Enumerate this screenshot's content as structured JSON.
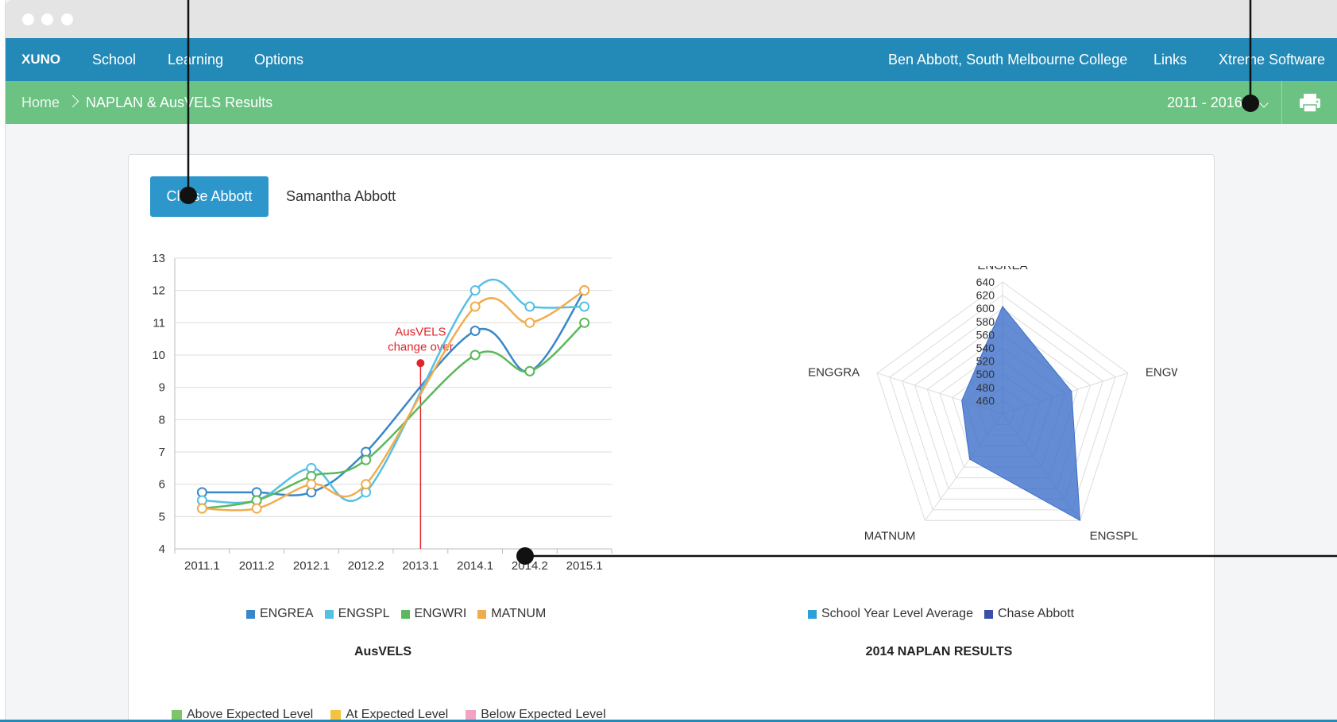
{
  "nav": {
    "logo": "XUNO",
    "items": [
      "School",
      "Learning",
      "Options"
    ],
    "user": "Ben Abbott, South Melbourne College",
    "links": "Links",
    "vendor": "Xtreme Software"
  },
  "breadcrumb": {
    "home": "Home",
    "current": "NAPLAN & AusVELS Results",
    "year_range": "2011 - 2016"
  },
  "icons": {
    "print": "printer-icon"
  },
  "student_tabs": [
    "Chase Abbott",
    "Samantha Abbott"
  ],
  "annotation": {
    "text_line1": "AusVELS",
    "text_line2": "change over",
    "color": "#e0242b"
  },
  "level_legend": [
    {
      "label": "Above Expected Level",
      "color": "#7dc46b"
    },
    {
      "label": "At Expected Level",
      "color": "#f5c242"
    },
    {
      "label": "Below Expected Level",
      "color": "#f2a3c4"
    }
  ],
  "chart_data": [
    {
      "type": "line",
      "title": "AusVELS",
      "x": [
        "2011.1",
        "2011.2",
        "2012.1",
        "2012.2",
        "2013.1",
        "2014.1",
        "2014.2",
        "2015.1"
      ],
      "ylim": [
        4,
        13
      ],
      "yticks": [
        4,
        5,
        6,
        7,
        8,
        9,
        10,
        11,
        12,
        13
      ],
      "grid": true,
      "legend_position": "bottom",
      "series": [
        {
          "name": "ENGREA",
          "color": "#3a87c8",
          "values": [
            5.75,
            5.75,
            5.75,
            7.0,
            null,
            10.75,
            9.5,
            12.0
          ]
        },
        {
          "name": "ENGSPL",
          "color": "#56c0e3",
          "values": [
            5.5,
            5.5,
            6.5,
            5.75,
            null,
            12.0,
            11.5,
            11.5
          ]
        },
        {
          "name": "ENGWRI",
          "color": "#5cb85c",
          "values": [
            5.25,
            5.5,
            6.25,
            6.75,
            null,
            10.0,
            9.5,
            11.0
          ]
        },
        {
          "name": "MATNUM",
          "color": "#f0ad4e",
          "values": [
            5.25,
            5.25,
            6.0,
            6.0,
            null,
            11.5,
            11.0,
            12.0
          ]
        }
      ],
      "annotations": [
        {
          "x": "2013.1",
          "label": "AusVELS change over"
        }
      ]
    },
    {
      "type": "radar",
      "title": "2014 NAPLAN RESULTS",
      "axes": [
        "ENGREA",
        "ENGWRI",
        "ENGSPL",
        "MATNUM",
        "ENGGRA"
      ],
      "rticks": [
        460,
        480,
        500,
        520,
        540,
        560,
        580,
        600,
        620,
        640
      ],
      "rlim": [
        440,
        640
      ],
      "legend_position": "bottom",
      "series": [
        {
          "name": "School Year Level Average",
          "color": "#2d9fd9",
          "values": []
        },
        {
          "name": "Chase Abbott",
          "color": "#3b4fa8",
          "values": [
            603,
            550,
            640,
            525,
            505
          ]
        }
      ]
    }
  ]
}
